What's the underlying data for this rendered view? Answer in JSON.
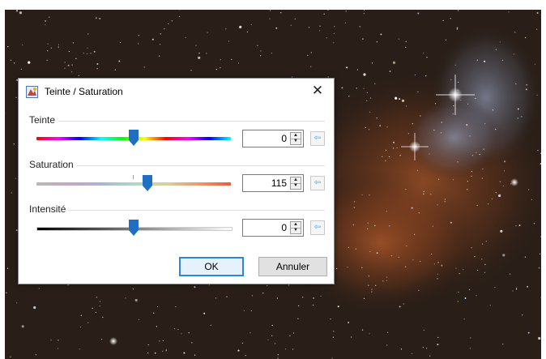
{
  "dialog": {
    "title": "Teinte / Saturation",
    "close_symbol": "✕",
    "groups": [
      {
        "label": "Teinte",
        "value": "0",
        "position": 0.5
      },
      {
        "label": "Saturation",
        "value": "115",
        "position": 0.57
      },
      {
        "label": "Intensité",
        "value": "0",
        "position": 0.5
      }
    ],
    "ok_label": "OK",
    "cancel_label": "Annuler",
    "spin_up_symbol": "▲",
    "spin_down_symbol": "▼",
    "reset_symbol": "⇦"
  },
  "icons": {
    "app": "hue-saturation-icon",
    "reset": "reset-arrow-icon"
  },
  "colors": {
    "accent": "#2d86d9",
    "thumb": "#1f6fc5",
    "reset_arrow": "#4b9fe0",
    "nebula": "#b05a2a",
    "nebula_glow": "#9aa6c4"
  }
}
